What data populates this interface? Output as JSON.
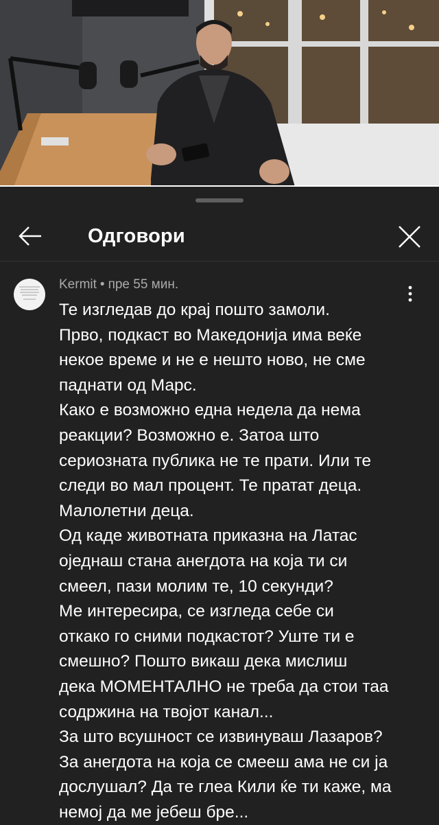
{
  "video": {
    "progress": 1.0
  },
  "header": {
    "title": "Одговори"
  },
  "comment": {
    "author": "Kermit",
    "separator": "•",
    "time": "пре 55 мин.",
    "lines": [
      "Те изгледав до крај пошто замоли.",
      "Прво, подкаст во Македонија има веќе",
      "некое време и не е нешто ново, не сме",
      "паднати од Марс.",
      "Како е возможно една недела да нема",
      "реакции? Возможно е. Затоа што",
      "сериозната публика не те прати. Или те",
      "следи во мал процент. Те пратат деца.",
      "Малолетни деца.",
      "Од каде животната приказна на Латас",
      "оједнаш стана анегдота на која ти си",
      "смеел, пази молим те, 10 секунди?",
      "Ме интересира, се изгледа себе си",
      "откако го сними подкастот? Уште ти е",
      "смешно? Пошто викаш дека мислиш",
      "дека МОМЕНТАЛНО не треба да стои таа",
      "содржина на твојот канал...",
      "За што всушност се извинуваш Лазаров?",
      "За анегдота на која се смееш ама не си ја",
      "дослушал? Да те глеа Кили ќе ти каже, ма",
      "немој да ме јебеш бре..."
    ]
  },
  "icons": {
    "back": "arrow-left-icon",
    "close": "close-icon",
    "more": "more-vert-icon"
  },
  "colors": {
    "background": "#212121",
    "text": "#ffffff",
    "meta": "#aaaaaa",
    "handle": "#5f5f5f"
  }
}
